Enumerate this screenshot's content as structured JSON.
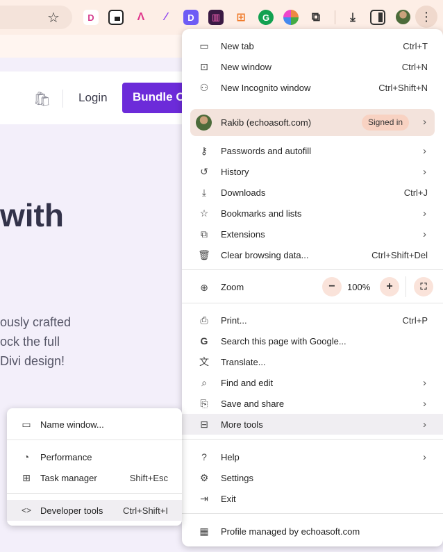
{
  "browser": {
    "menu_icon": "more-vert-icon"
  },
  "site": {
    "login_label": "Login",
    "bundle_label": "Bundle O",
    "hero_title": "with",
    "hero_lines": [
      "ously crafted",
      "ock the full",
      "Divi design!"
    ]
  },
  "menu": {
    "new_tab": {
      "label": "New tab",
      "shortcut": "Ctrl+T"
    },
    "new_window": {
      "label": "New window",
      "shortcut": "Ctrl+N"
    },
    "incognito": {
      "label": "New Incognito window",
      "shortcut": "Ctrl+Shift+N"
    },
    "profile": {
      "name": "Rakib (echoasoft.com)",
      "badge": "Signed in"
    },
    "passwords": {
      "label": "Passwords and autofill"
    },
    "history": {
      "label": "History"
    },
    "downloads": {
      "label": "Downloads",
      "shortcut": "Ctrl+J"
    },
    "bookmarks": {
      "label": "Bookmarks and lists"
    },
    "extensions": {
      "label": "Extensions"
    },
    "clear": {
      "label": "Clear browsing data...",
      "shortcut": "Ctrl+Shift+Del"
    },
    "zoom": {
      "label": "Zoom",
      "value": "100%",
      "minus": "−",
      "plus": "+"
    },
    "print": {
      "label": "Print...",
      "shortcut": "Ctrl+P"
    },
    "search_google": {
      "label": "Search this page with Google..."
    },
    "translate": {
      "label": "Translate..."
    },
    "find_edit": {
      "label": "Find and edit"
    },
    "save_share": {
      "label": "Save and share"
    },
    "more_tools": {
      "label": "More tools"
    },
    "help": {
      "label": "Help"
    },
    "settings": {
      "label": "Settings"
    },
    "exit": {
      "label": "Exit"
    },
    "managed": {
      "label": "Profile managed by echoasoft.com"
    }
  },
  "submenu": {
    "name_window": {
      "label": "Name window..."
    },
    "performance": {
      "label": "Performance"
    },
    "task_manager": {
      "label": "Task manager",
      "shortcut": "Shift+Esc"
    },
    "dev_tools": {
      "label": "Developer tools",
      "shortcut": "Ctrl+Shift+I"
    }
  }
}
